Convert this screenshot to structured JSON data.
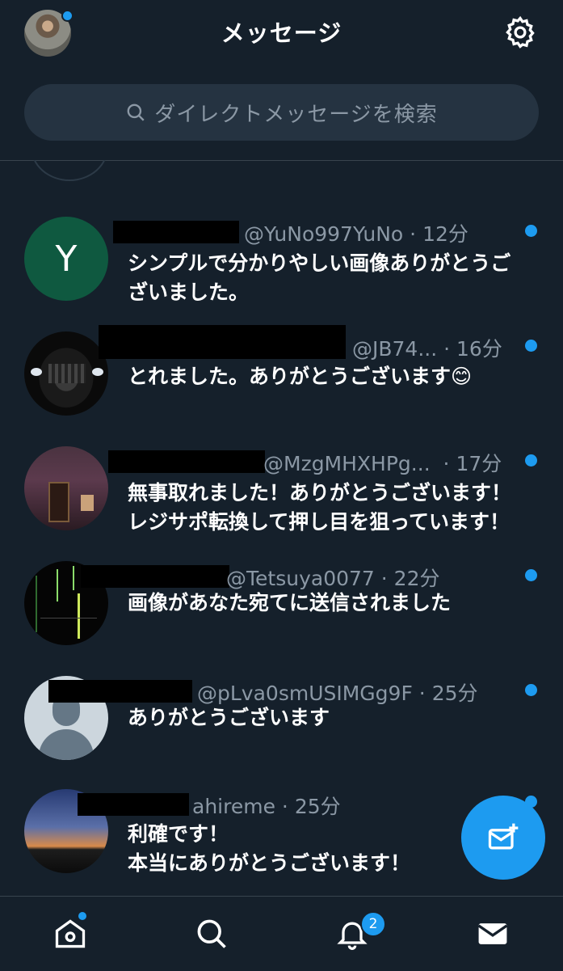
{
  "header": {
    "title": "メッセージ"
  },
  "search": {
    "placeholder": "ダイレクトメッセージを検索"
  },
  "conversations": [
    {
      "handle": "@YuNo997YuNo",
      "time": "12分",
      "message": [
        "シンプルで分かりやしい画像ありがとうご",
        "ざいました。"
      ],
      "avatar_letter": "Y",
      "unread": true
    },
    {
      "handle": "@JB74...",
      "time": "16分",
      "message": [
        "とれました。ありがとうございます😊"
      ],
      "unread": true
    },
    {
      "handle": "@MzgMHXHPg...",
      "time": "17分",
      "message": [
        "無事取れました！ありがとうございます！",
        "レジサポ転換して押し目を狙っています！"
      ],
      "unread": true
    },
    {
      "handle": "@Tetsuya0077",
      "time": "22分",
      "message": [
        "画像があなた宛てに送信されました"
      ],
      "unread": true
    },
    {
      "handle": "@pLva0smUSIMGg9F",
      "time": "25分",
      "message": [
        "ありがとうございます"
      ],
      "unread": true
    },
    {
      "handle": "ahireme",
      "time": "25分",
      "message": [
        "利確です！",
        "本当にありがとうございます！"
      ],
      "unread": true
    }
  ],
  "tabbar": {
    "items": [
      {
        "name": "home",
        "icon": "home-icon"
      },
      {
        "name": "search",
        "icon": "search-icon"
      },
      {
        "name": "notifications",
        "icon": "bell-icon",
        "badge": "2"
      },
      {
        "name": "messages",
        "icon": "mail-icon"
      }
    ]
  },
  "colors": {
    "background": "#15202b",
    "accent": "#1d9bf0",
    "muted": "#8b98a5"
  }
}
